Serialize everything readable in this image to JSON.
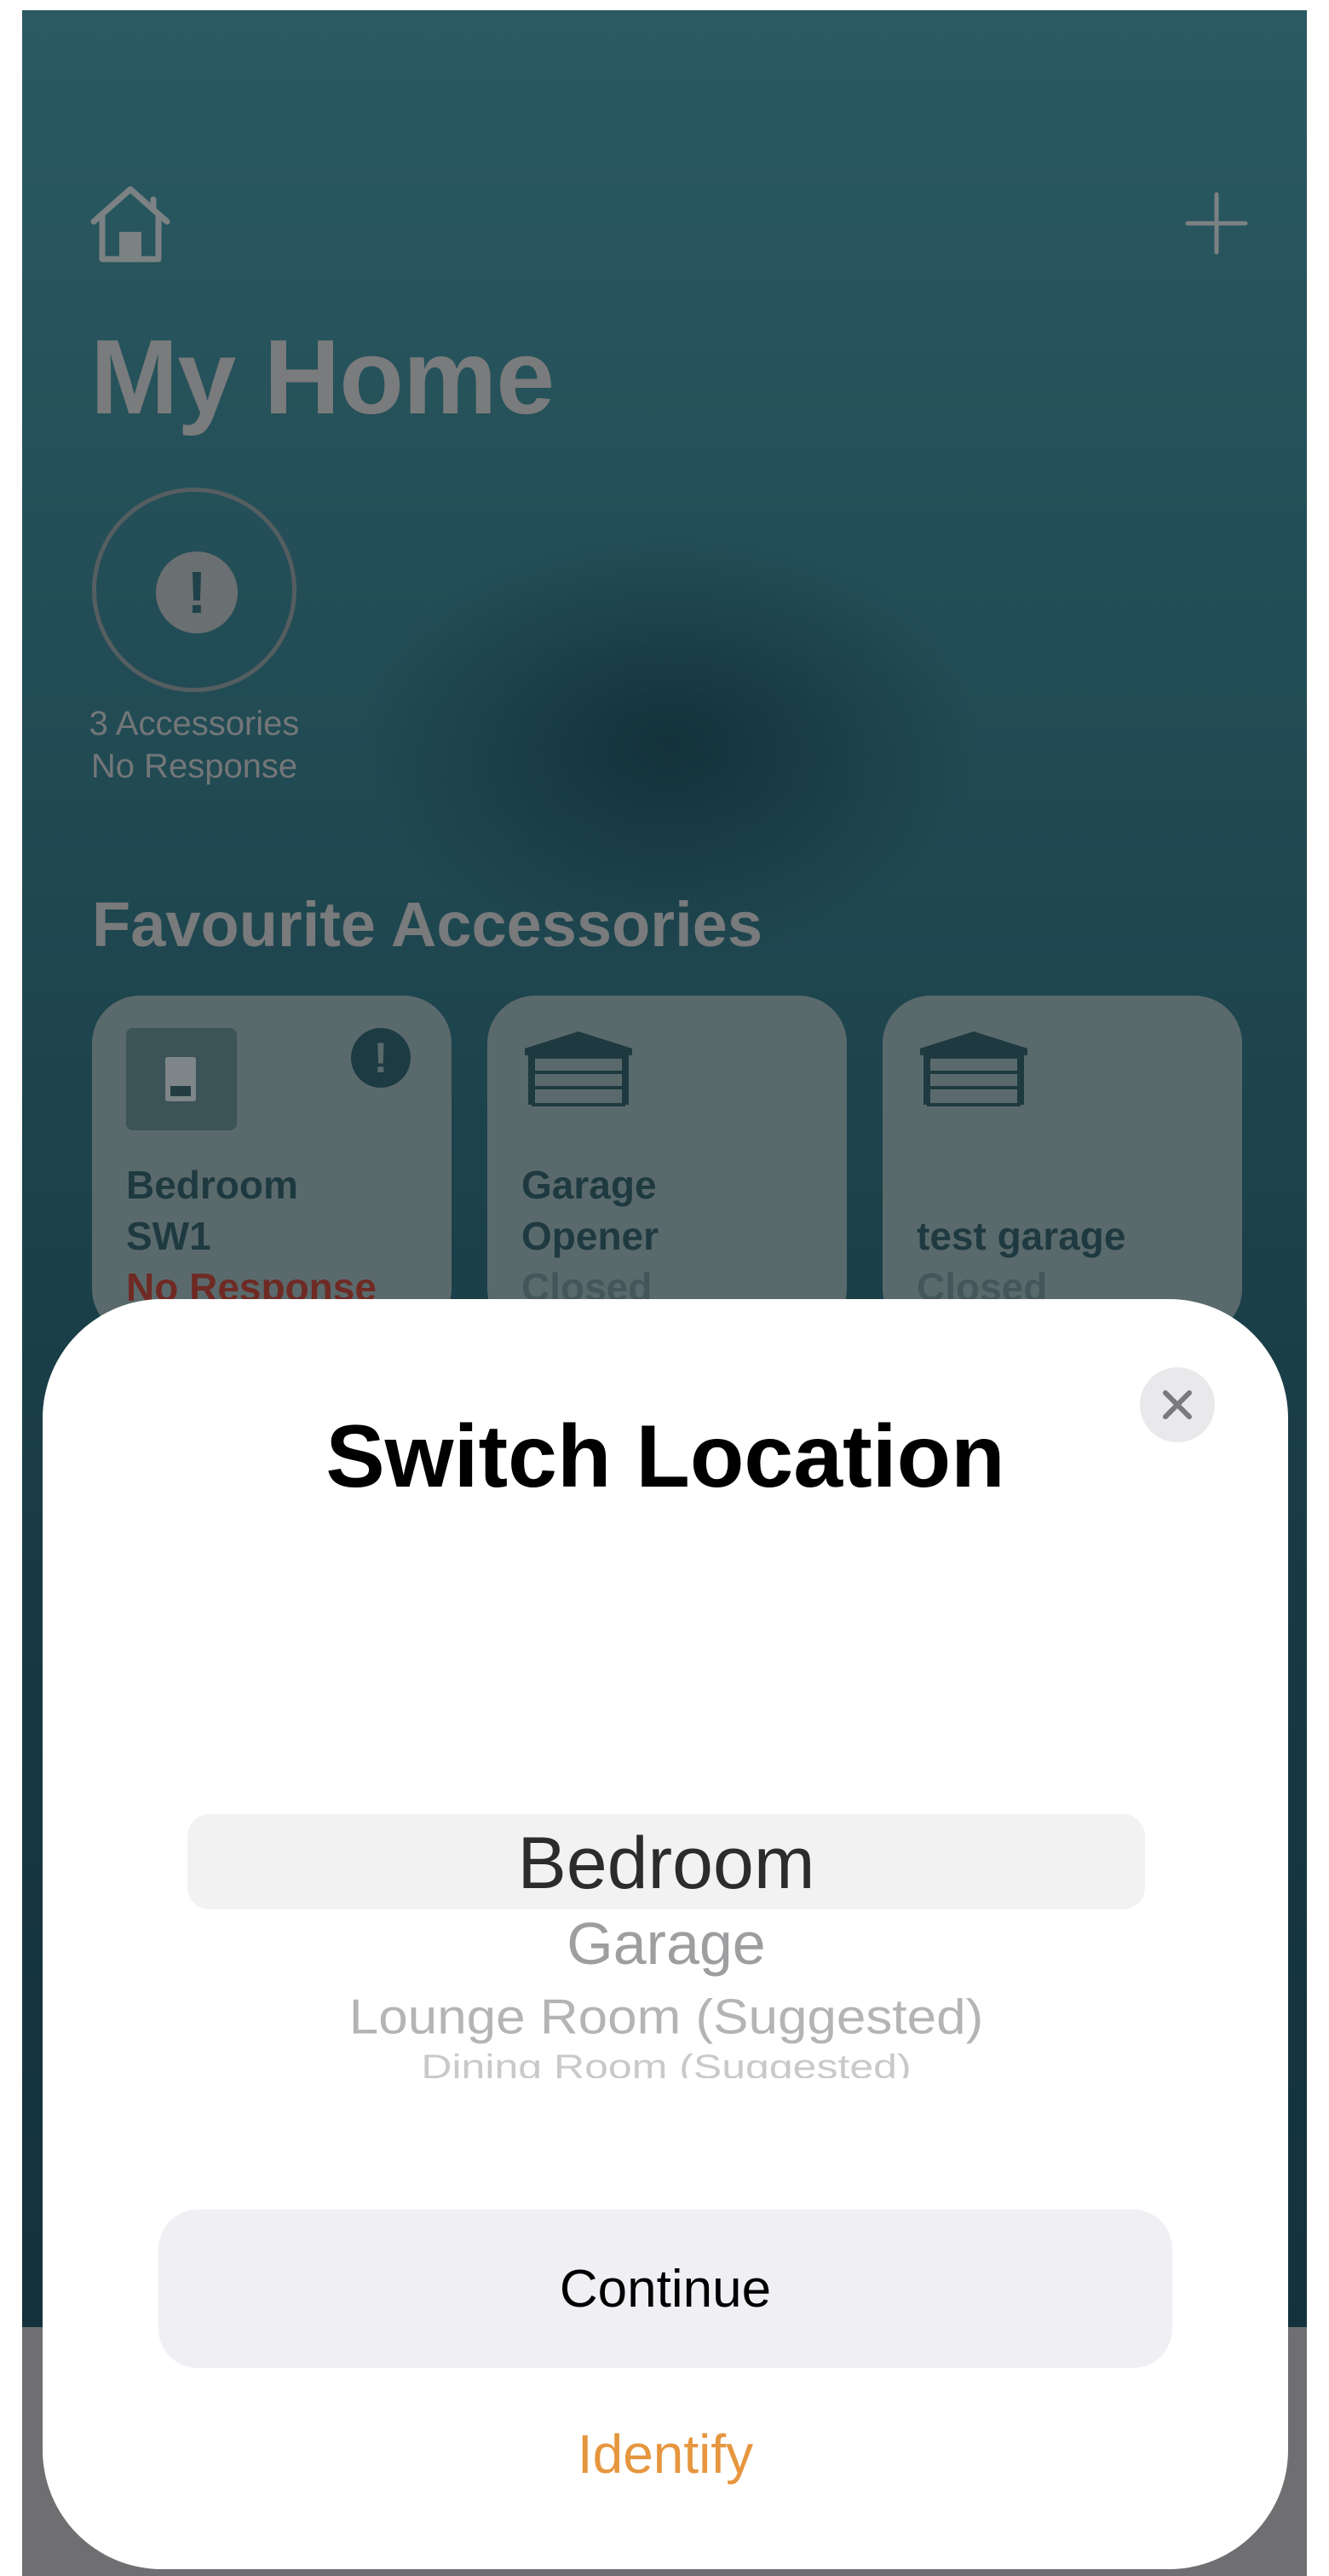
{
  "home": {
    "title": "My Home",
    "status": {
      "line1": "3 Accessories",
      "line2": "No Response",
      "badge": "!"
    },
    "favourites_title": "Favourite Accessories",
    "tiles": [
      {
        "name_line1": "Bedroom",
        "name_line2": "SW1",
        "status": "No Response",
        "icon": "light-switch-icon",
        "alert": "!"
      },
      {
        "name_line1": "Garage",
        "name_line2": "Opener",
        "status": "Closed",
        "icon": "garage-door-icon"
      },
      {
        "name_line1": "test garage",
        "status": "Closed",
        "icon": "garage-door-icon"
      }
    ]
  },
  "sheet": {
    "title": "Switch Location",
    "close_icon": "close-icon",
    "picker": {
      "selected": "Bedroom",
      "options": [
        "Bedroom",
        "Garage",
        "Lounge Room (Suggested)",
        "Dining Room (Suggested)"
      ]
    },
    "continue_label": "Continue",
    "identify_label": "Identify"
  },
  "colors": {
    "accent": "#e6963e",
    "alert_red": "#b03a2e",
    "sheet_bg": "#ffffff"
  }
}
